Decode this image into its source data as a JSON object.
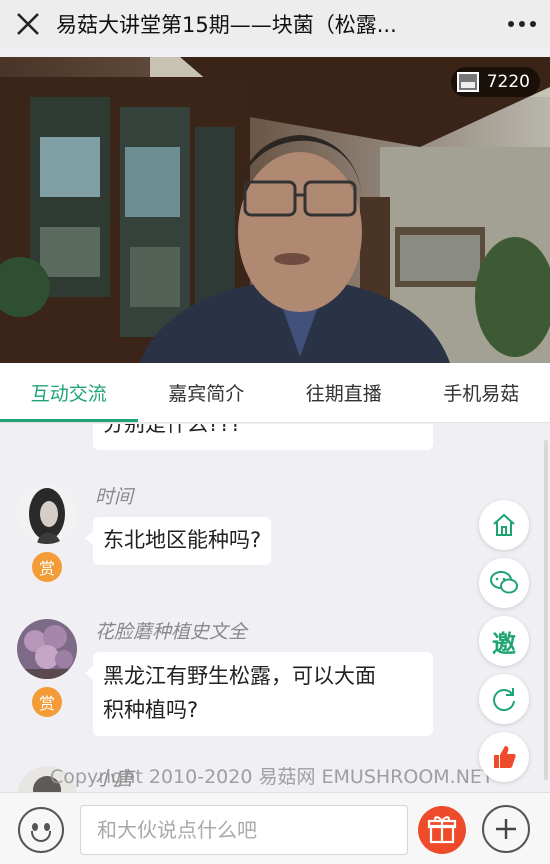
{
  "header": {
    "title": "易菇大讲堂第15期——块菌（松露...",
    "close_icon": "×",
    "more_icon": "•••"
  },
  "video": {
    "viewer_count": "7220"
  },
  "tabs": [
    {
      "label": "互动交流",
      "active": true
    },
    {
      "label": "嘉宾简介",
      "active": false
    },
    {
      "label": "往期直播",
      "active": false
    },
    {
      "label": "手机易菇",
      "active": false
    }
  ],
  "chat": {
    "partial_message": "分别是什么???",
    "messages": [
      {
        "user": "时间",
        "text": "东北地区能种吗?",
        "reward_label": "赏"
      },
      {
        "user": "花脸蘑种植史文全",
        "text_line1": "黑龙江有野生松露，可以大面",
        "text_line2": "积种植吗?",
        "reward_label": "赏"
      },
      {
        "user": "小唐"
      }
    ]
  },
  "float_buttons": {
    "invite_label": "邀"
  },
  "watermark": "Copyright 2010-2020 易菇网 EMUSHROOM.NET",
  "input": {
    "placeholder": "和大伙说点什么吧"
  },
  "colors": {
    "accent": "#20a474",
    "reward": "#f29b37",
    "gift": "#ee4b2b"
  }
}
